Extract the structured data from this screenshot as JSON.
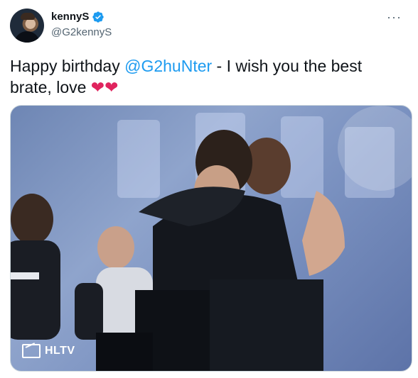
{
  "user": {
    "display_name": "kennyS",
    "handle": "@G2kennyS"
  },
  "tweet": {
    "text_before": "Happy birthday ",
    "mention": "@G2huNter",
    "text_after": " - I wish you the best brate, love ",
    "hearts": "❤❤"
  },
  "media": {
    "watermark": "HLTV"
  },
  "icons": {
    "verified": "verified-badge-icon",
    "more": "more-options-icon"
  },
  "colors": {
    "mention": "#1d9bf0",
    "verified": "#1d9bf0",
    "heart": "#e0245e"
  }
}
